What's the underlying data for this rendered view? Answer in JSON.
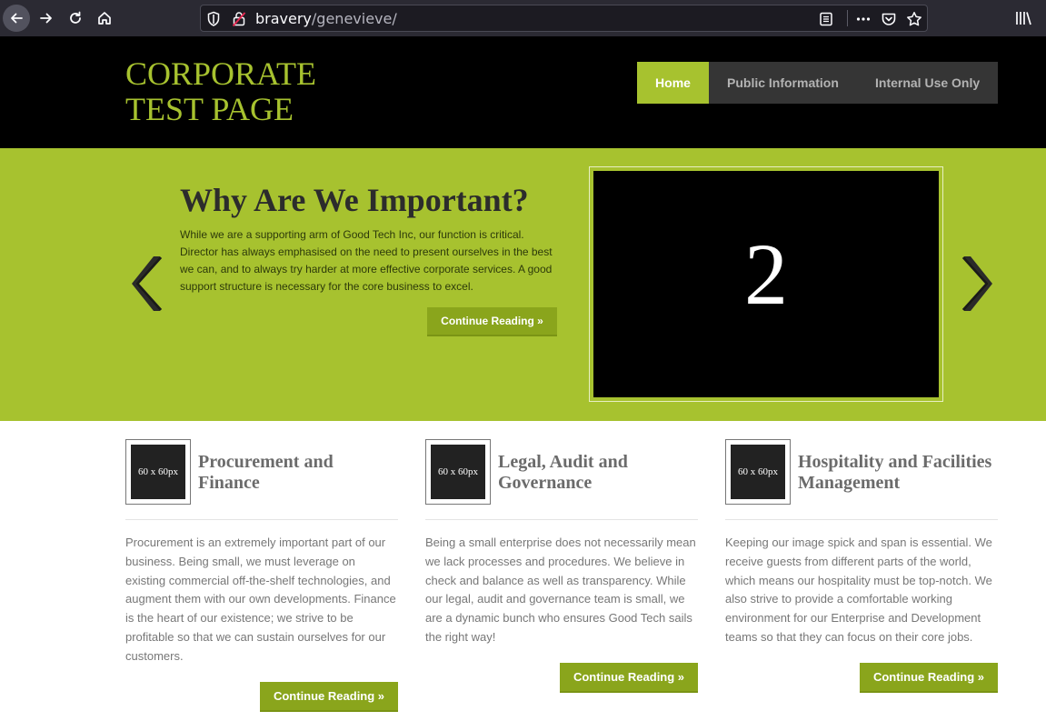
{
  "browser": {
    "url_host": "bravery",
    "url_path": "/genevieve/"
  },
  "site": {
    "logo_line1": "CORPORATE",
    "logo_line2": "TEST PAGE",
    "nav": {
      "home": "Home",
      "public": "Public Information",
      "internal": "Internal Use Only"
    }
  },
  "slider": {
    "title": "Why Are We Important?",
    "text": "While we are a supporting arm of Good Tech Inc, our function is critical. Director has always emphasised on the need to present ourselves in the best we can, and to always try harder at more effective corporate services. A good support structure is necessary for the core business to excel.",
    "button": "Continue Reading »",
    "slide_number": "2"
  },
  "features": [
    {
      "thumb": "60 x 60px",
      "title": "Procurement and Finance",
      "text": "Procurement is an extremely important part of our business. Being small, we must leverage on existing commercial off-the-shelf technologies, and augment them with our own developments. Finance is the heart of our existence; we strive to be profitable so that we can sustain ourselves for our customers.",
      "button": "Continue Reading »"
    },
    {
      "thumb": "60 x 60px",
      "title": "Legal, Audit and Governance",
      "text": "Being a small enterprise does not necessarily mean we lack processes and procedures. We believe in check and balance as well as transparency. While our legal, audit and governance team is small, we are a dynamic bunch who ensures Good Tech sails the right way!",
      "button": "Continue Reading »"
    },
    {
      "thumb": "60 x 60px",
      "title": "Hospitality and Facilities Management",
      "text": "Keeping our image spick and span is essential. We receive guests from different parts of the world, which means our hospitality must be top-notch. We also strive to provide a comfortable working environment for our Enterprise and Development teams so that they can focus on their core jobs.",
      "button": "Continue Reading »"
    }
  ],
  "icons": {
    "back": "back-arrow-icon",
    "forward": "forward-arrow-icon",
    "reload": "reload-icon",
    "home": "home-icon",
    "shield": "tracking-shield-icon",
    "lock": "insecure-lock-icon",
    "reader": "reader-view-icon",
    "more": "more-actions-icon",
    "pocket": "pocket-icon",
    "star": "bookmark-star-icon",
    "library": "library-icon",
    "prev": "slider-prev-icon",
    "next": "slider-next-icon"
  },
  "colors": {
    "accent": "#a7c22f",
    "button": "#8aa51c",
    "header_bg": "#000000",
    "nav_bg": "#353535"
  }
}
